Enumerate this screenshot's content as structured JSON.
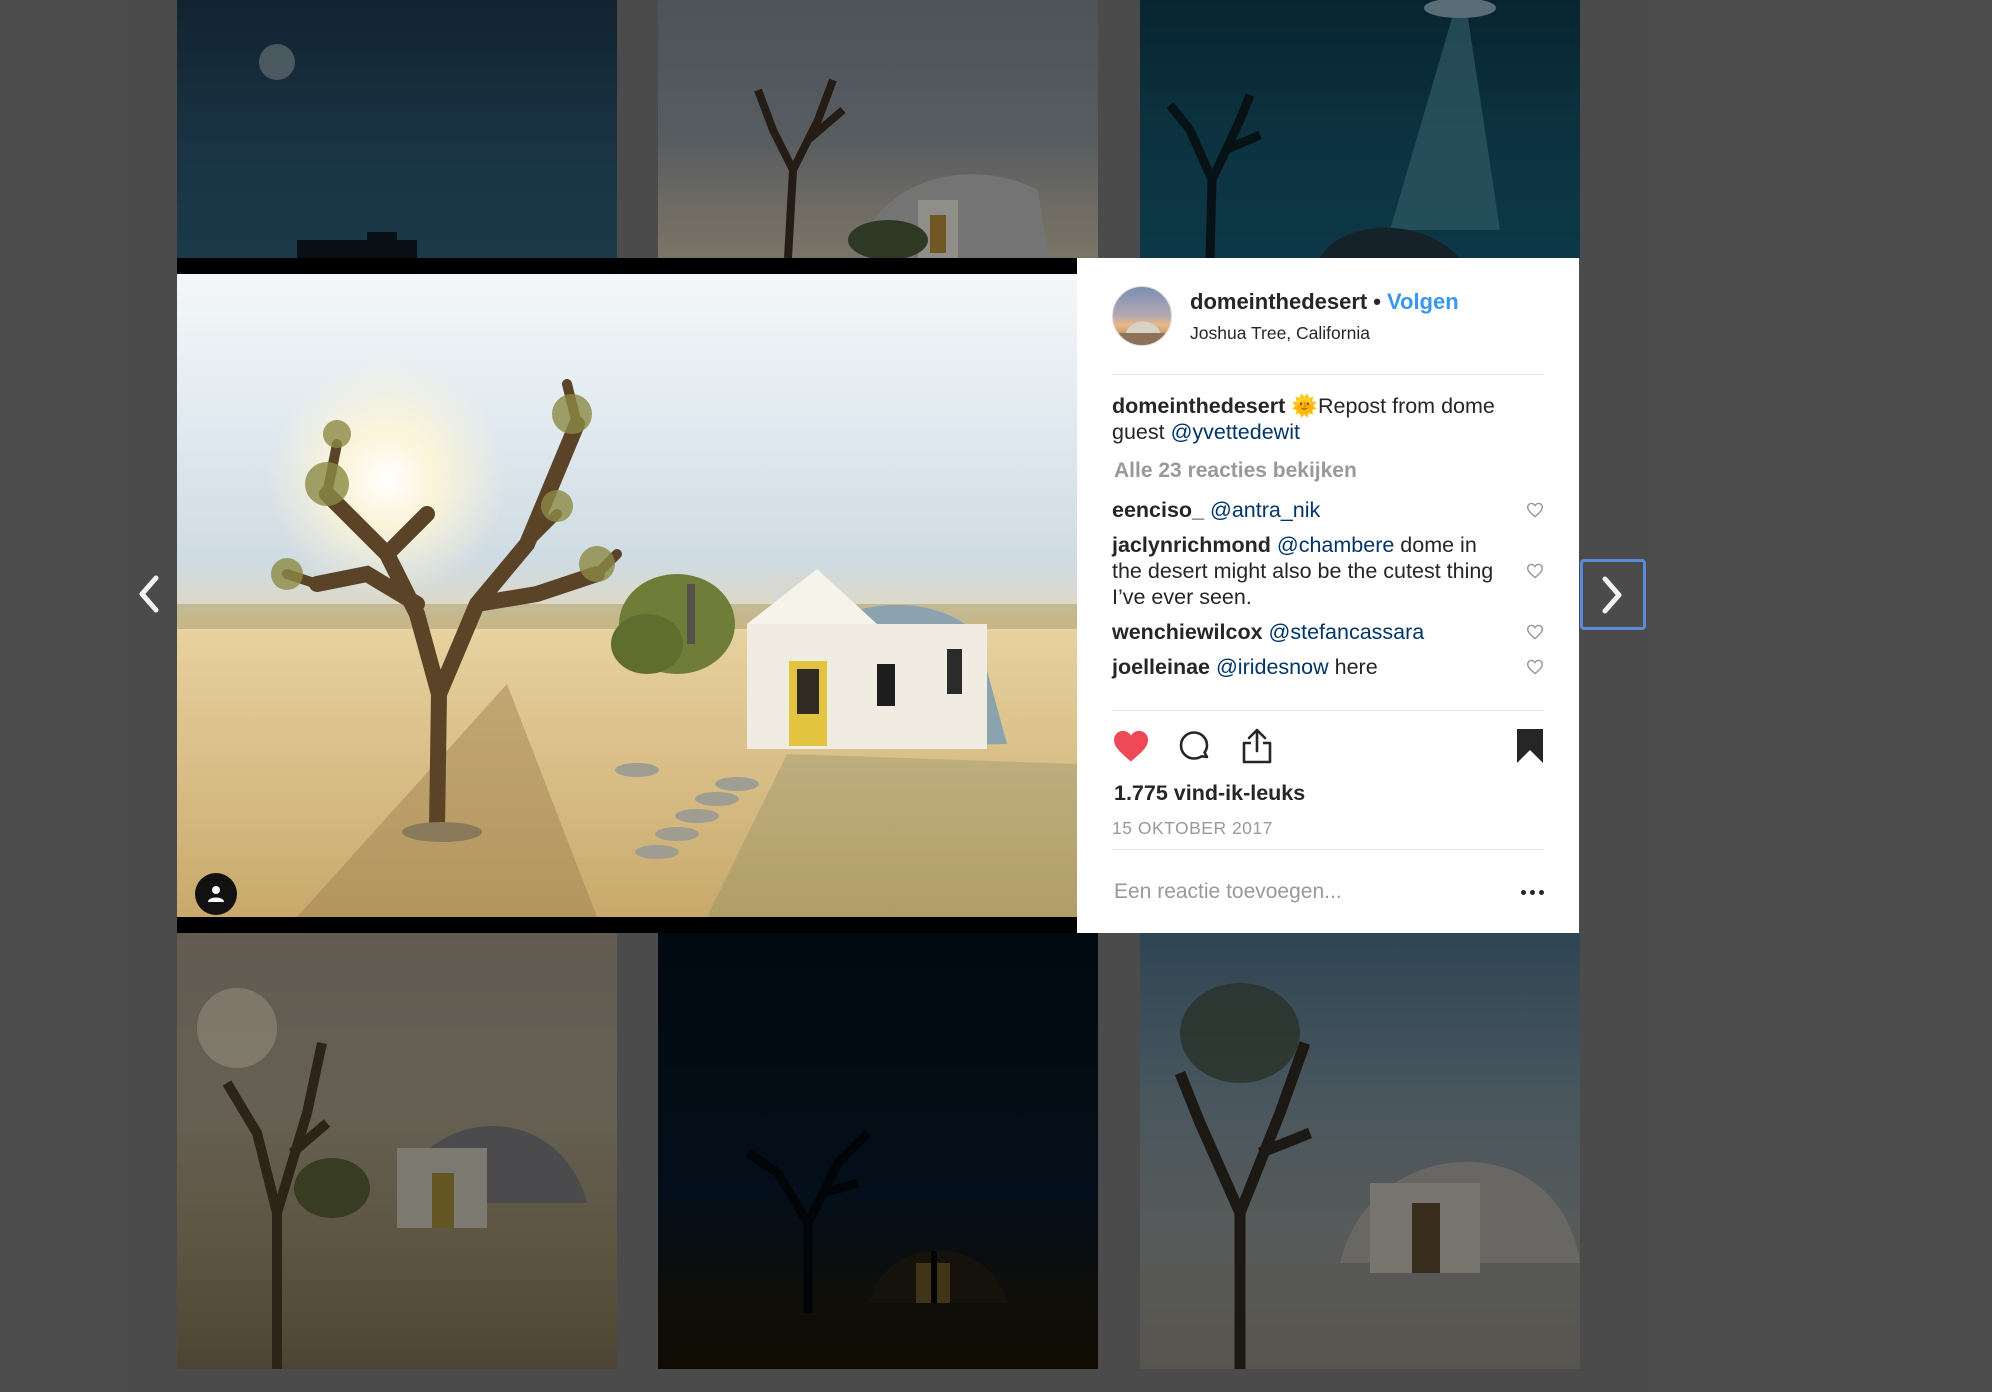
{
  "post": {
    "username": "domeinthedesert",
    "separator": "•",
    "follow_label": "Volgen",
    "location": "Joshua Tree, California",
    "caption": {
      "username": "domeinthedesert",
      "emoji": "🌞",
      "text_before": "Repost from dome guest ",
      "mention": "@yvettedewit"
    },
    "view_all_label": "Alle 23 reacties bekijken",
    "comments": [
      {
        "username": "eenciso_",
        "mention": "@antra_nik",
        "text": ""
      },
      {
        "username": "jaclynrichmond",
        "mention": "@chambere",
        "text": " dome in the desert might also be the cutest thing I’ve ever seen."
      },
      {
        "username": "wenchiewilcox",
        "mention": "@stefancassara",
        "text": ""
      },
      {
        "username": "joelleinae",
        "mention": "@iridesnow",
        "text": " here"
      }
    ],
    "likes": "1.775 vind-ik-leuks",
    "date": "15 OKTOBER 2017",
    "comment_placeholder": "Een reactie toevoegen...",
    "liked": true
  },
  "icons": {
    "like": "heart-icon",
    "comment": "comment-icon",
    "share": "share-icon",
    "save": "bookmark-icon",
    "more": "more-icon",
    "prev": "chevron-left-icon",
    "next": "chevron-right-icon",
    "tag": "user-tag-icon"
  },
  "colors": {
    "link": "#3897f0",
    "mention": "#003569",
    "like_red": "#ed4956",
    "focus_ring": "#5b8bd6"
  }
}
